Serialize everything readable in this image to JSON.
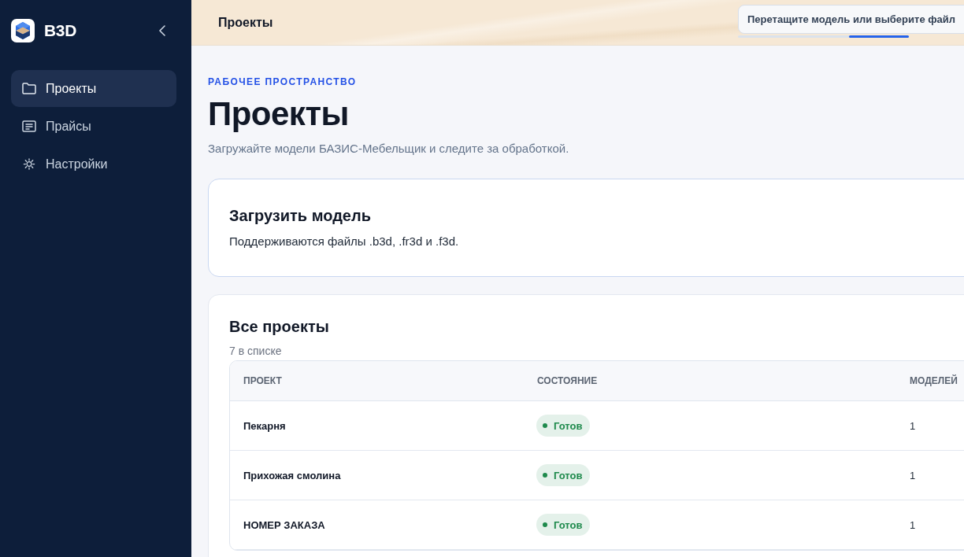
{
  "sidebar": {
    "brand": "B3D",
    "items": [
      {
        "label": "Проекты",
        "kind": "folder",
        "selected": true
      },
      {
        "label": "Прайсы",
        "kind": "list",
        "selected": false
      },
      {
        "label": "Настройки",
        "kind": "settings",
        "selected": false
      }
    ]
  },
  "topbar": {
    "title": "Проекты",
    "drop_hint": "Перетащите модель или выберите файл",
    "progress": {
      "level": 0.35
    }
  },
  "header": {
    "eyebrow": "РАБОЧЕЕ ПРОСТРАНСТВО",
    "title": "Проекты",
    "subtitle": "Загружайте модели БАЗИС-Мебельщик и следите за обработкой."
  },
  "upload_card": {
    "title": "Загрузить модель",
    "text": "Поддерживаются файлы .b3d, .fr3d и .f3d."
  },
  "projects": {
    "title": "Все проекты",
    "count": "7 в списке",
    "table": {
      "columns": [
        "ПРОЕКТ",
        "СОСТОЯНИЕ",
        "МОДЕЛЕЙ"
      ],
      "rows": [
        {
          "name": "Пекарня",
          "status": {
            "label": "Готов",
            "color": "#1e8a4c"
          },
          "models": "1"
        },
        {
          "name": "Прихожая смолина",
          "status": {
            "label": "Готов",
            "color": "#1e8a4c"
          },
          "models": "1"
        },
        {
          "name": "НОМЕР ЗАКАЗА",
          "status": {
            "label": "Готов",
            "color": "#1e8a4c"
          },
          "models": "1"
        }
      ]
    }
  }
}
